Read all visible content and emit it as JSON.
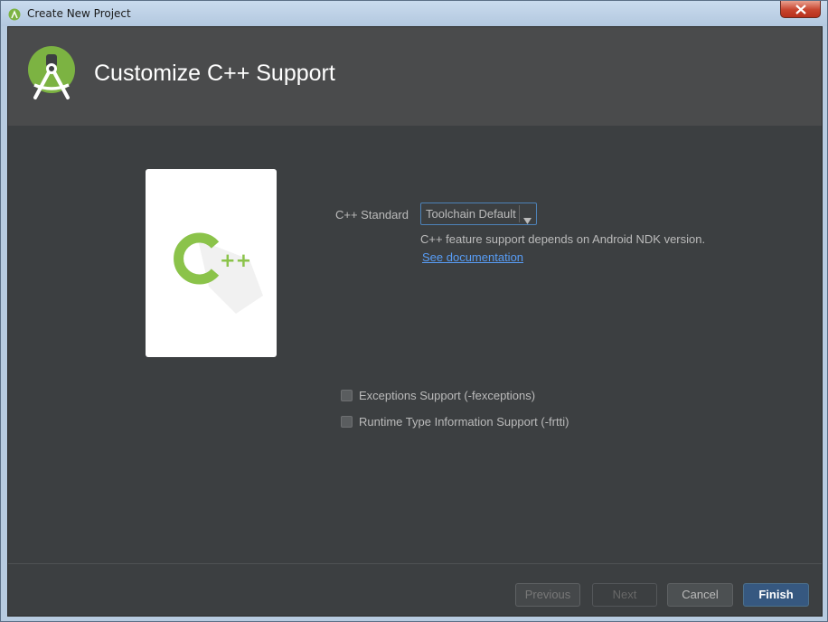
{
  "window": {
    "title": "Create New Project",
    "close_icon": "close-x-icon"
  },
  "header": {
    "title": "Customize C++ Support",
    "logo_icon": "android-studio-logo-icon"
  },
  "preview": {
    "icon": "cpp-logo-icon",
    "letter": "C",
    "plus": "++"
  },
  "cpp_standard": {
    "label": "C++ Standard",
    "selected": "Toolchain Default",
    "hint": "C++ feature support depends on Android NDK version.",
    "link": "See documentation"
  },
  "options": [
    {
      "label": "Exceptions Support (-fexceptions)",
      "checked": false
    },
    {
      "label": "Runtime Type Information Support (-frtti)",
      "checked": false
    }
  ],
  "buttons": {
    "previous": "Previous",
    "next": "Next",
    "cancel": "Cancel",
    "finish": "Finish"
  },
  "colors": {
    "accent_green": "#8bc34a",
    "link": "#589df6",
    "background": "#3c3f41",
    "header": "#4a4b4c"
  }
}
